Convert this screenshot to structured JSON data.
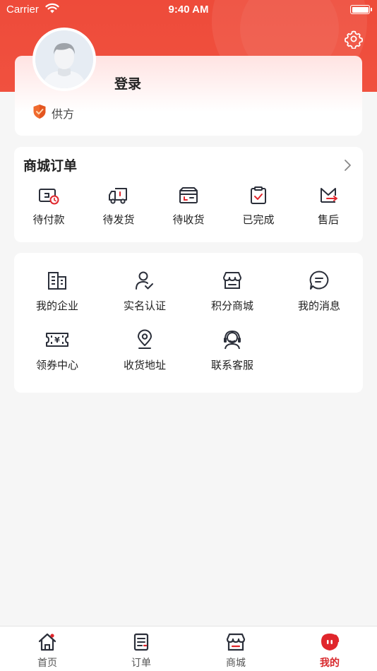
{
  "status_bar": {
    "carrier": "Carrier",
    "time": "9:40 AM"
  },
  "profile": {
    "login_label": "登录",
    "role": "供方"
  },
  "orders": {
    "title": "商城订单",
    "items": [
      {
        "label": "待付款",
        "icon": "wallet-clock-icon"
      },
      {
        "label": "待发货",
        "icon": "truck-icon"
      },
      {
        "label": "待收货",
        "icon": "box-icon"
      },
      {
        "label": "已完成",
        "icon": "clipboard-check-icon"
      },
      {
        "label": "售后",
        "icon": "return-icon"
      }
    ]
  },
  "services": {
    "items": [
      {
        "label": "我的企业",
        "icon": "building-icon"
      },
      {
        "label": "实名认证",
        "icon": "user-verify-icon"
      },
      {
        "label": "积分商城",
        "icon": "shop-icon"
      },
      {
        "label": "我的消息",
        "icon": "message-icon"
      },
      {
        "label": "领券中心",
        "icon": "coupon-icon"
      },
      {
        "label": "收货地址",
        "icon": "location-icon"
      },
      {
        "label": "联系客服",
        "icon": "headset-icon"
      }
    ]
  },
  "tabbar": {
    "items": [
      {
        "label": "首页",
        "icon": "home-icon"
      },
      {
        "label": "订单",
        "icon": "order-doc-icon"
      },
      {
        "label": "商城",
        "icon": "store-icon"
      },
      {
        "label": "我的",
        "icon": "me-icon",
        "active": true
      }
    ]
  },
  "colors": {
    "brand": "#ee4b3a",
    "accent": "#d8262a",
    "background": "#f6f6f6"
  }
}
